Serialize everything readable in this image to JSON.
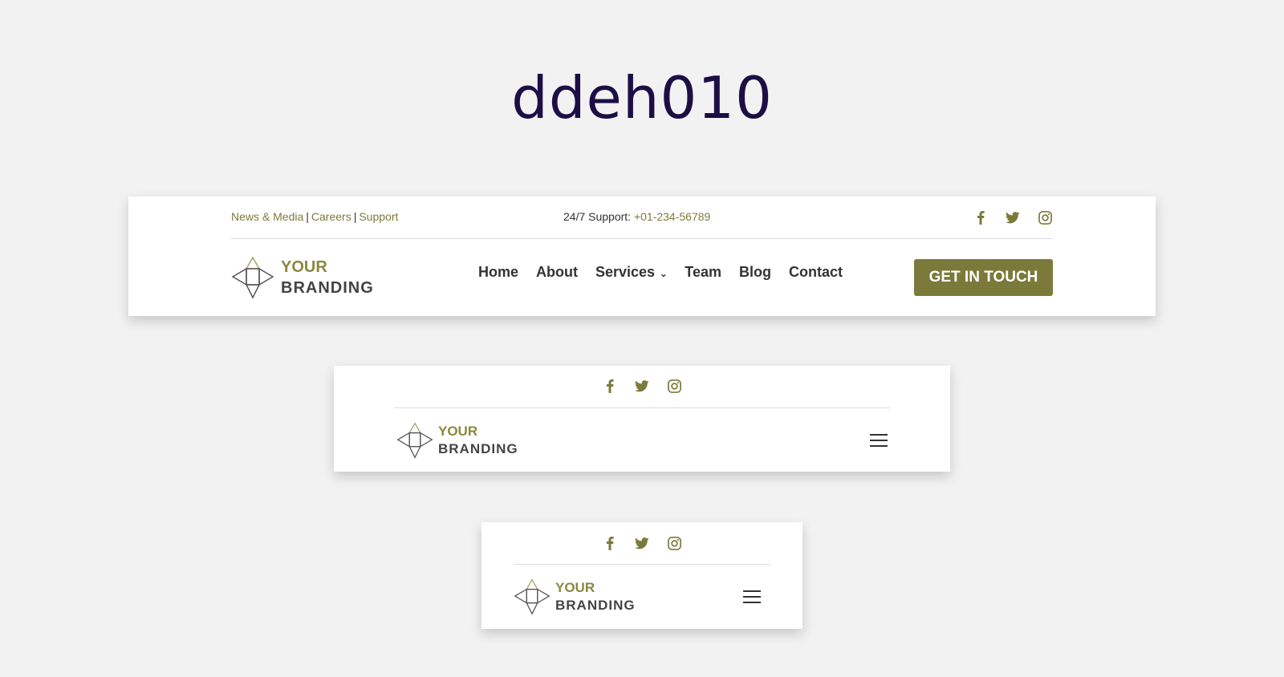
{
  "page": {
    "title": "ddeh010"
  },
  "desktop": {
    "top_links": [
      "News & Media",
      "Careers",
      "Support"
    ],
    "separator": "|",
    "support_label": "24/7 Support:",
    "support_phone": "+01-234-56789",
    "nav": [
      "Home",
      "About",
      "Services",
      "Team",
      "Blog",
      "Contact"
    ],
    "cta": "GET IN TOUCH"
  },
  "logo": {
    "line1": "YOUR",
    "line2": "BRANDING"
  },
  "social": [
    "facebook-icon",
    "twitter-icon",
    "instagram-icon"
  ],
  "colors": {
    "accent": "#7c7a3a",
    "title": "#1b0f45",
    "background": "#f2f2f2"
  }
}
